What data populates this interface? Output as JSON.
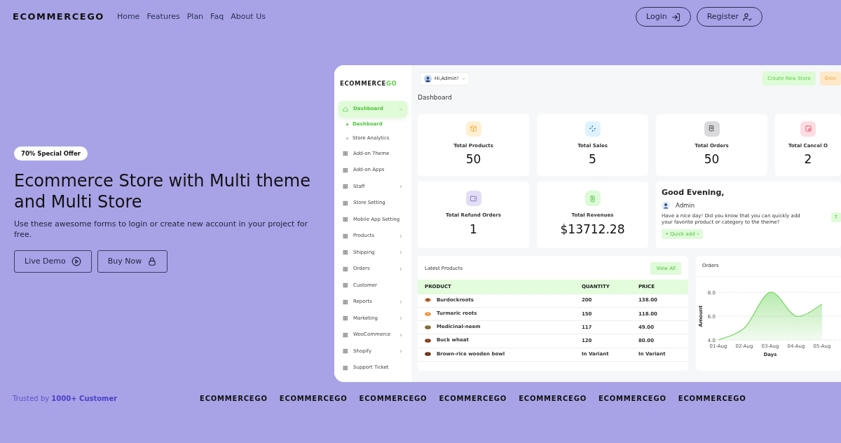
{
  "nav": {
    "logo": "ECOMMERCEGO",
    "links": [
      {
        "label": "Home"
      },
      {
        "label": "Features"
      },
      {
        "label": "Plan"
      },
      {
        "label": "Faq"
      },
      {
        "label": "About Us"
      }
    ],
    "buttons": [
      {
        "label": "Login",
        "kind": "login"
      },
      {
        "label": "Register",
        "kind": "register"
      }
    ]
  },
  "hero": {
    "badge": "70% Special Offer",
    "title": "Ecommerce Store with Multi theme and Multi Store",
    "text": "Use these awesome forms to login or create new account in your project for free.",
    "buttons": [
      {
        "label": "Live Demo",
        "kind": "play"
      },
      {
        "label": "Buy Now",
        "kind": "lock"
      }
    ]
  },
  "dashboard": {
    "logo": {
      "text": "ECOMMERCE",
      "accent": "GO"
    },
    "user": "Hi,Admin!",
    "header_buttons": [
      {
        "label": "Create New Store",
        "color": "#ddfbd6"
      },
      {
        "label": "Groc",
        "color": "#ffe9c9"
      }
    ],
    "title": "Dashboard",
    "sidebar": [
      {
        "label": "Dashboard",
        "selected": true,
        "expanded": true,
        "has_children": true,
        "children": [
          {
            "label": "Dashboard",
            "selected": true
          },
          {
            "label": "Store Analytics",
            "selected": false
          }
        ]
      },
      {
        "label": "Add-on Theme",
        "selected": false,
        "has_children": false
      },
      {
        "label": "Add-on Apps",
        "selected": false,
        "has_children": false
      },
      {
        "label": "Staff",
        "selected": false,
        "has_children": true
      },
      {
        "label": "Store Setting",
        "selected": false,
        "has_children": false
      },
      {
        "label": "Mobile App Setting",
        "selected": false,
        "has_children": false
      },
      {
        "label": "Products",
        "selected": false,
        "has_children": true
      },
      {
        "label": "Shipping",
        "selected": false,
        "has_children": true
      },
      {
        "label": "Orders",
        "selected": false,
        "has_children": true
      },
      {
        "label": "Customer",
        "selected": false,
        "has_children": false
      },
      {
        "label": "Reports",
        "selected": false,
        "has_children": true
      },
      {
        "label": "Marketing",
        "selected": false,
        "has_children": true
      },
      {
        "label": "WooCommerce",
        "selected": false,
        "has_children": true
      },
      {
        "label": "Shopify",
        "selected": false,
        "has_children": true
      },
      {
        "label": "Support Ticket",
        "selected": false,
        "has_children": false
      }
    ],
    "stats": [
      {
        "label": "Total Products",
        "value": "50",
        "color": "#fff0d4"
      },
      {
        "label": "Total Sales",
        "value": "5",
        "color": "#def3ff"
      },
      {
        "label": "Total Orders",
        "value": "50",
        "color": "#d9d9db"
      },
      {
        "label": "Total Cancel O",
        "value": "2",
        "color": "#ffdde2"
      },
      {
        "label": "Total Refund Orders",
        "value": "1",
        "color": "#e3def5"
      },
      {
        "label": "Total Revenues",
        "value": "$13712.28",
        "color": "#dcfbd6"
      }
    ],
    "greeting": {
      "title": "Good Evening,",
      "name": "Admin",
      "text": "Have a nice day! Did you know that you can quickly add your favorite product or category to the theme?",
      "button": "Quick add",
      "edge_button": "T"
    },
    "products": {
      "title": "Latest Products",
      "button": "View All",
      "columns": [
        "PRODUCT",
        "QUANTITY",
        "PRICE"
      ],
      "rows": [
        [
          "Burdockroots",
          "200",
          "138.00"
        ],
        [
          "Turmeric roots",
          "150",
          "118.00"
        ],
        [
          "Medicinal-neem",
          "117",
          "49.00"
        ],
        [
          "Buck wheat",
          "120",
          "80.00"
        ],
        [
          "Brown-rice wooden bowl",
          "In Variant",
          "In Variant"
        ]
      ]
    },
    "orders": {
      "chart_data": {
        "type": "area",
        "title": "Orders",
        "xlabel": "Days",
        "ylabel": "Amount",
        "categories": [
          "01-Aug",
          "02-Aug",
          "03-Aug",
          "04-Aug",
          "05-Aug"
        ],
        "series": [
          {
            "color": "#7ed96d",
            "values": [
              4,
              5,
              8,
              6,
              7
            ]
          }
        ],
        "ylim": [
          4,
          8
        ],
        "yticks": [
          {
            "value": 4,
            "label": "4.0"
          },
          {
            "value": 6,
            "label": "6.0"
          },
          {
            "value": 8,
            "label": "8.0"
          }
        ]
      }
    }
  },
  "footer": {
    "trusted": "Trusted by **1000+ Customer**",
    "logos": [
      "ECOMMERCEGO",
      "ECOMMERCEGO",
      "ECOMMERCEGO",
      "ECOMMERCEGO",
      "ECOMMERCEGO",
      "ECOMMERCEGO",
      "ECOMMERCEGO"
    ]
  }
}
